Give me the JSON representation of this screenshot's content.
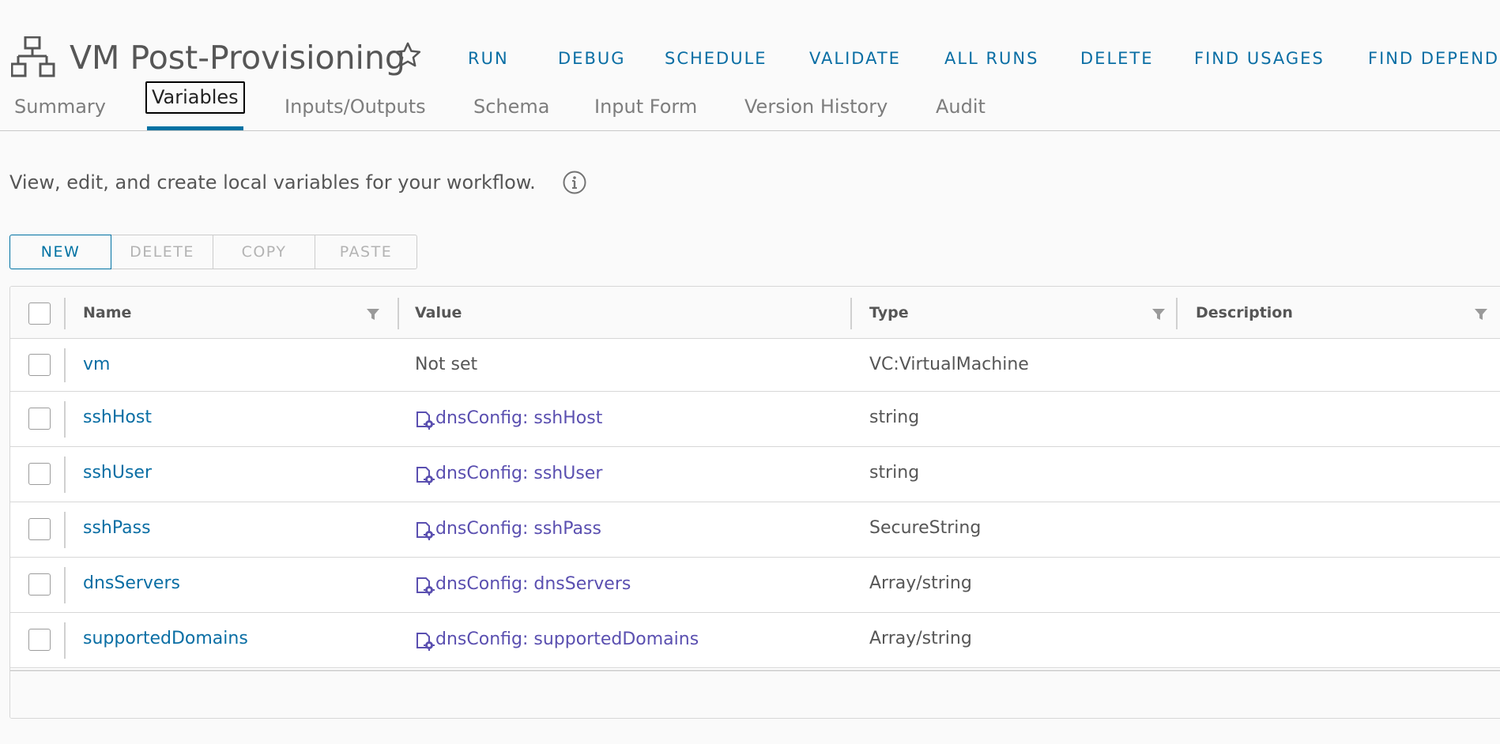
{
  "header": {
    "title": "VM Post-Provisioning",
    "icons": {
      "workflow": "workflow-icon",
      "favorite": "star-icon"
    },
    "actions": [
      "RUN",
      "DEBUG",
      "SCHEDULE",
      "VALIDATE",
      "ALL RUNS",
      "DELETE",
      "FIND USAGES",
      "FIND DEPEND"
    ]
  },
  "tabs": [
    {
      "label": "Summary",
      "active": false
    },
    {
      "label": "Variables",
      "active": true
    },
    {
      "label": "Inputs/Outputs",
      "active": false
    },
    {
      "label": "Schema",
      "active": false
    },
    {
      "label": "Input Form",
      "active": false
    },
    {
      "label": "Version History",
      "active": false
    },
    {
      "label": "Audit",
      "active": false
    }
  ],
  "description": {
    "text": "View, edit, and create local variables for your workflow.",
    "icon": "info-icon"
  },
  "toolbar": {
    "new_label": "NEW",
    "delete_label": "DELETE",
    "copy_label": "COPY",
    "paste_label": "PASTE"
  },
  "grid": {
    "columns": {
      "name": "Name",
      "value": "Value",
      "type": "Type",
      "description": "Description"
    },
    "rows": [
      {
        "name": "vm",
        "value": "Not set",
        "bound": false,
        "type": "VC:VirtualMachine",
        "description": ""
      },
      {
        "name": "sshHost",
        "value": "dnsConfig: sshHost",
        "bound": true,
        "type": "string",
        "description": ""
      },
      {
        "name": "sshUser",
        "value": "dnsConfig: sshUser",
        "bound": true,
        "type": "string",
        "description": ""
      },
      {
        "name": "sshPass",
        "value": "dnsConfig: sshPass",
        "bound": true,
        "type": "SecureString",
        "description": ""
      },
      {
        "name": "dnsServers",
        "value": "dnsConfig: dnsServers",
        "bound": true,
        "type": "Array/string",
        "description": ""
      },
      {
        "name": "supportedDomains",
        "value": "dnsConfig: supportedDomains",
        "bound": true,
        "type": "Array/string",
        "description": ""
      }
    ]
  },
  "colors": {
    "accent": "#0072a3",
    "link": "#0a6ea4",
    "config_binding": "#5a4fb0"
  }
}
